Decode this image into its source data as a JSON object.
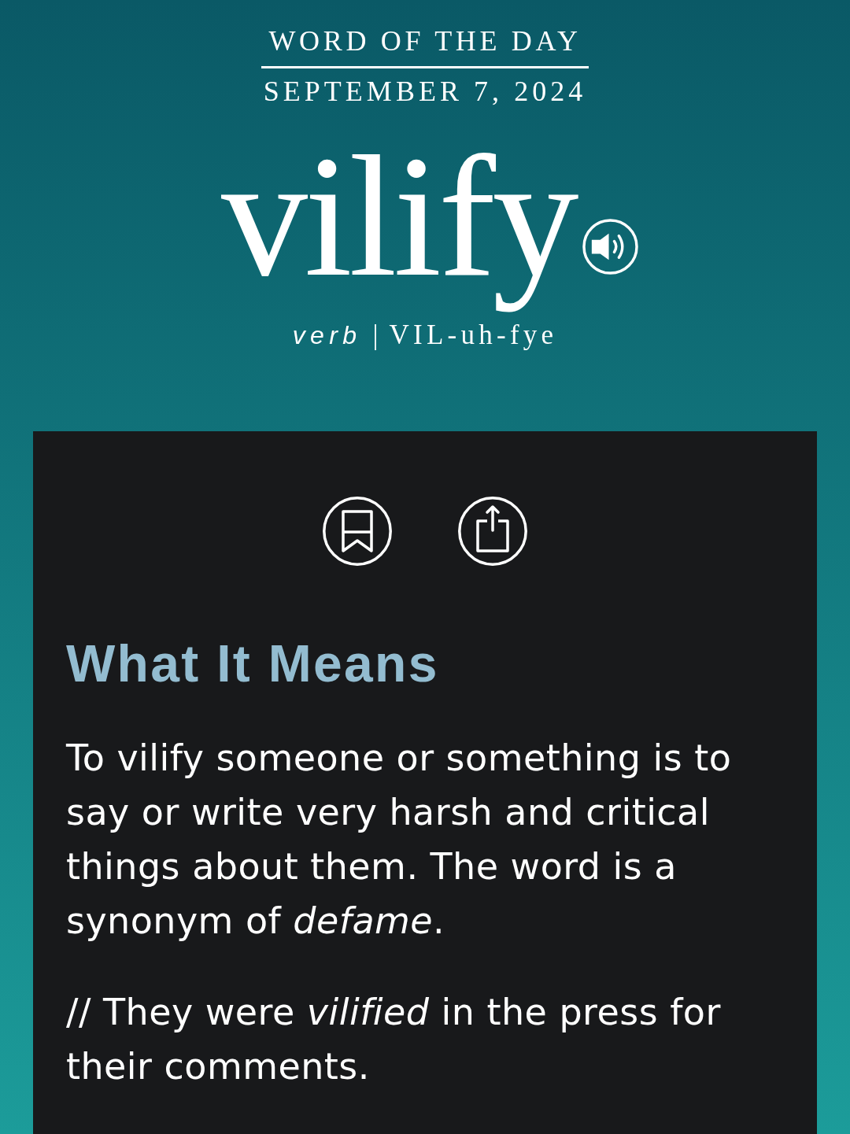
{
  "header": {
    "kicker": "WORD OF THE DAY",
    "date": "SEPTEMBER 7, 2024"
  },
  "word": {
    "headword": "vilify",
    "part_of_speech": "verb",
    "separator": "|",
    "pronunciation": "VIL-uh-fye"
  },
  "definition_card": {
    "heading": "What It Means",
    "definition": "To vilify someone or something is to say or write very harsh and critical things about them. The word is a synonym of *defame*.",
    "example": "// They were *vilified* in the press for their comments."
  }
}
